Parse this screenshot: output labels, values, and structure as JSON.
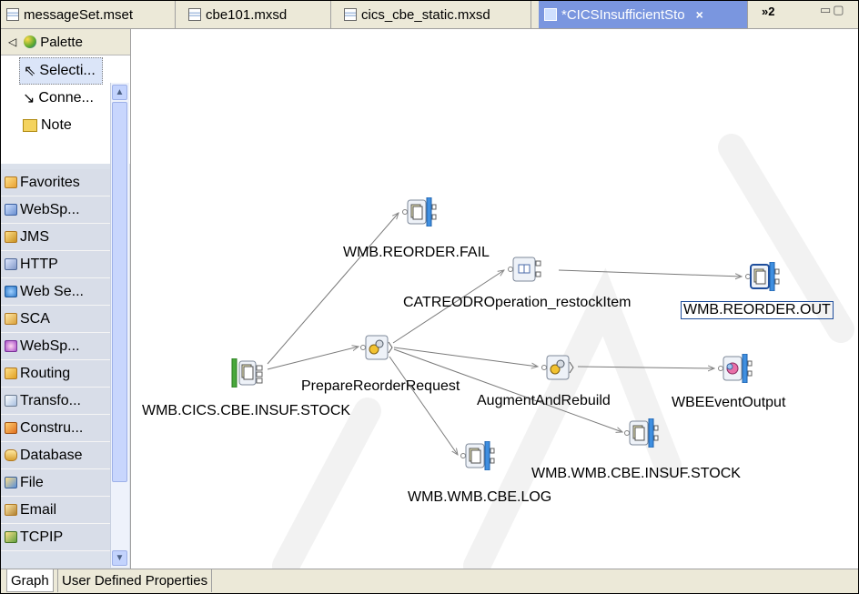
{
  "tabs": [
    {
      "label": "messageSet.mset",
      "icon": "message-set-icon"
    },
    {
      "label": "cbe101.mxsd",
      "icon": "schema-file-icon"
    },
    {
      "label": "cics_cbe_static.mxsd",
      "icon": "schema-file-icon"
    },
    {
      "label": "*CICSInsufficientSto",
      "icon": "message-flow-icon",
      "active": true,
      "close": "×"
    }
  ],
  "tab_overflow": "»2",
  "palette": {
    "title": "Palette",
    "tools": [
      {
        "label": "Selecti...",
        "icon": "arrow-pointer-icon",
        "selected": true
      },
      {
        "label": "Conne...",
        "icon": "connection-icon"
      },
      {
        "label": "Note",
        "icon": "note-icon"
      }
    ],
    "drawers": [
      {
        "label": "Favorites",
        "icon": "favorites-icon"
      },
      {
        "label": "WebSp...",
        "icon": "mq-icon"
      },
      {
        "label": "JMS",
        "icon": "jms-icon"
      },
      {
        "label": "HTTP",
        "icon": "http-icon"
      },
      {
        "label": "Web Se...",
        "icon": "web-services-icon"
      },
      {
        "label": "SCA",
        "icon": "sca-icon"
      },
      {
        "label": "WebSp...",
        "icon": "websphere-adapters-icon"
      },
      {
        "label": "Routing",
        "icon": "routing-icon"
      },
      {
        "label": "Transfo...",
        "icon": "transformation-icon"
      },
      {
        "label": "Constru...",
        "icon": "construction-icon"
      },
      {
        "label": "Database",
        "icon": "database-icon"
      },
      {
        "label": "File",
        "icon": "file-icon"
      },
      {
        "label": "Email",
        "icon": "email-icon"
      },
      {
        "label": "TCPIP",
        "icon": "tcpip-icon"
      }
    ]
  },
  "flow": {
    "nodes": [
      {
        "id": "input",
        "label": "WMB.CICS.CBE.INSUF.STOCK",
        "kind": "mq-input"
      },
      {
        "id": "fail",
        "label": "WMB.REORDER.FAIL",
        "kind": "mq-output"
      },
      {
        "id": "catre",
        "label": "CATREODROperation_restockItem",
        "kind": "subflow"
      },
      {
        "id": "out",
        "label": "WMB.REORDER.OUT",
        "kind": "mq-output",
        "selected": true
      },
      {
        "id": "prep",
        "label": "PrepareReorderRequest",
        "kind": "compute"
      },
      {
        "id": "augment",
        "label": "AugmentAndRebuild",
        "kind": "compute"
      },
      {
        "id": "wbe",
        "label": "WBEEventOutput",
        "kind": "event-output"
      },
      {
        "id": "wmbstock",
        "label": "WMB.WMB.CBE.INSUF.STOCK",
        "kind": "mq-output"
      },
      {
        "id": "log",
        "label": "WMB.WMB.CBE.LOG",
        "kind": "mq-output"
      }
    ],
    "watermark_color": "#f4f4f4"
  },
  "bottom_tabs": [
    {
      "label": "Graph",
      "active": true
    },
    {
      "label": "User Defined Properties"
    }
  ]
}
